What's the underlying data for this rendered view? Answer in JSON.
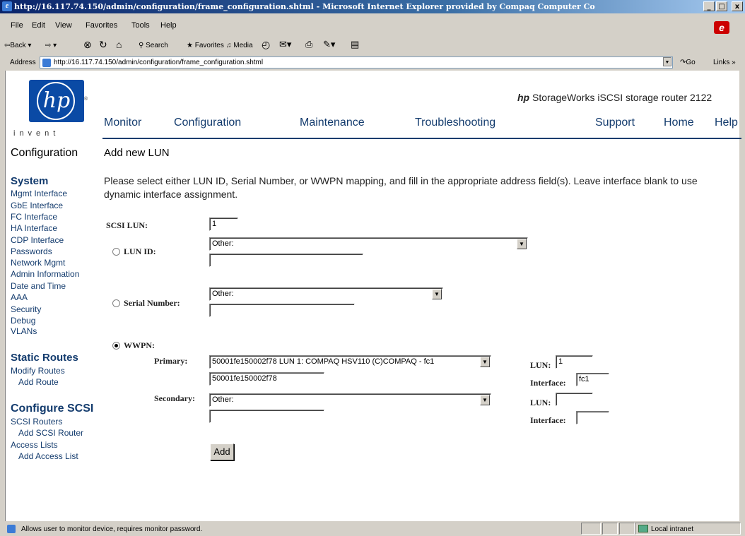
{
  "window": {
    "title": "http://16.117.74.150/admin/configuration/frame_configuration.shtml - Microsoft Internet Explorer provided by Compaq Computer Co",
    "minimize": "_",
    "restore": "□",
    "close": "x"
  },
  "menubar": [
    "File",
    "Edit",
    "View",
    "Favorites",
    "Tools",
    "Help"
  ],
  "toolbar": {
    "back": "⇦Back ▾",
    "forward": "⇨ ▾",
    "stop": "⊗",
    "refresh": "↻",
    "home": "⌂",
    "search": "Search",
    "favorites": "Favorites",
    "media": "Media",
    "history": "◴",
    "mail": "✉▾",
    "print": "⎙",
    "edit": "✎▾",
    "discuss": "▤"
  },
  "address": {
    "label": "Address",
    "url": "http://16.117.74.150/admin/configuration/frame_configuration.shtml",
    "go": "Go",
    "links": "Links »"
  },
  "header": {
    "logo_text": "hp",
    "logo_tm": "®",
    "tagline": "invent",
    "product_brand": "hp",
    "product_name": "StorageWorks iSCSI storage router 2122",
    "nav": [
      "Monitor",
      "Configuration",
      "Maintenance",
      "Troubleshooting",
      "Support",
      "Home",
      "Help"
    ]
  },
  "sidebar": {
    "section_title": "Configuration",
    "system": {
      "title": "System",
      "items": [
        "Mgmt Interface",
        "GbE Interface",
        "FC Interface",
        "HA Interface",
        "CDP Interface",
        "Passwords",
        "Network Mgmt",
        "Admin Information",
        "Date and Time",
        "AAA",
        "Security",
        "Debug",
        "VLANs"
      ]
    },
    "static_routes": {
      "title": "Static Routes",
      "items": [
        "Modify Routes",
        "Add Route"
      ]
    },
    "configure_scsi": {
      "title": "Configure SCSI",
      "items": [
        "SCSI Routers",
        "Add SCSI Router",
        "Access Lists",
        "Add Access List"
      ]
    }
  },
  "main": {
    "title": "Add new LUN",
    "instructions": "Please select either LUN ID, Serial Number, or WWPN mapping, and fill in the appropriate address field(s). Leave interface blank to use dynamic interface assignment.",
    "scsi_lun_label": "SCSI LUN:",
    "scsi_lun_value": "1",
    "lun_id": {
      "label": "LUN ID:",
      "select": "Other:",
      "input": ""
    },
    "serial_number": {
      "label": "Serial Number:",
      "select": "Other:",
      "input": ""
    },
    "wwpn": {
      "label": "WWPN:",
      "primary_label": "Primary:",
      "primary_select": "50001fe150002f78 LUN 1: COMPAQ HSV110 (C)COMPAQ - fc1",
      "primary_input": "50001fe150002f78",
      "primary_lun_label": "LUN:",
      "primary_lun": "1",
      "primary_interface_label": "Interface:",
      "primary_interface": "fc1",
      "secondary_label": "Secondary:",
      "secondary_select": "Other:",
      "secondary_input": "",
      "secondary_lun_label": "LUN:",
      "secondary_lun": "",
      "secondary_interface_label": "Interface:",
      "secondary_interface": ""
    },
    "add_button": "Add"
  },
  "statusbar": {
    "text": "Allows user to monitor device, requires monitor password.",
    "zone": "Local intranet"
  }
}
